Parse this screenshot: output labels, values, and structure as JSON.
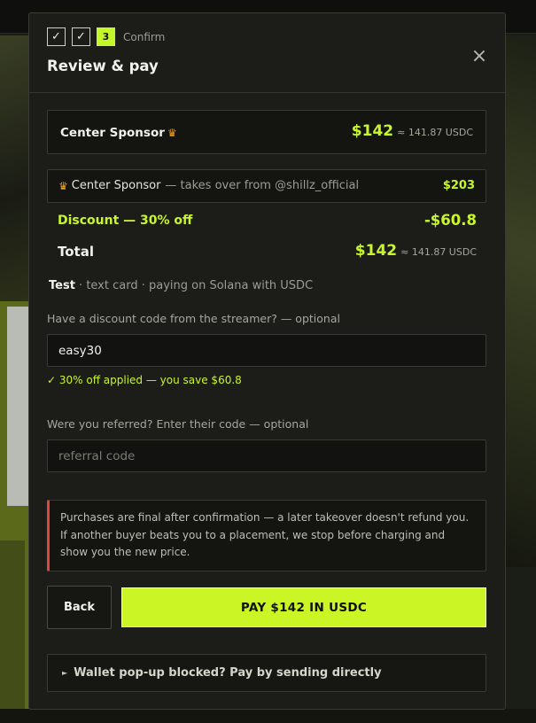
{
  "steps": {
    "done1": "✓",
    "done2": "✓",
    "current_number": "3",
    "current_label": "Confirm"
  },
  "header": {
    "title": "Review & pay",
    "close_glyph": "×"
  },
  "item": {
    "name": "Center Sponsor",
    "crown_glyph": "♛",
    "price": "$142",
    "price_usdc": "≈ 141.87 USDC"
  },
  "takeover": {
    "crown_glyph": "♛",
    "name": "Center Sponsor",
    "subtitle": "— takes over from @shillz_official",
    "price": "$203"
  },
  "discount": {
    "label": "Discount — 30% off",
    "value": "-$60.8"
  },
  "total": {
    "label": "Total",
    "price": "$142",
    "price_usdc": "≈ 141.87 USDC"
  },
  "meta": {
    "name": "Test",
    "details": " · text card · paying on Solana with USDC"
  },
  "discount_code": {
    "label": "Have a discount code from the streamer? — optional",
    "value": "easy30",
    "applied_message": "✓ 30% off applied — you save $60.8"
  },
  "referral": {
    "label": "Were you referred? Enter their code — optional",
    "placeholder": "referral code"
  },
  "notice": {
    "line1": "Purchases are final after confirmation — a later takeover doesn't refund you.",
    "line2": "If another buyer beats you to a placement, we stop before charging and",
    "line3": "show you the new price."
  },
  "buttons": {
    "back": "Back",
    "pay": "PAY $142 IN USDC"
  },
  "wallet": {
    "triangle_glyph": "►",
    "label": "Wallet pop-up blocked? Pay by sending directly"
  },
  "colors": {
    "accent": "#c8f52c",
    "warning_border": "#e0473a",
    "crown": "#f0a020",
    "modal_bg": "#1c1d19"
  },
  "icons": [
    "check-icon",
    "close-icon",
    "crown-icon",
    "disclosure-triangle-icon"
  ]
}
